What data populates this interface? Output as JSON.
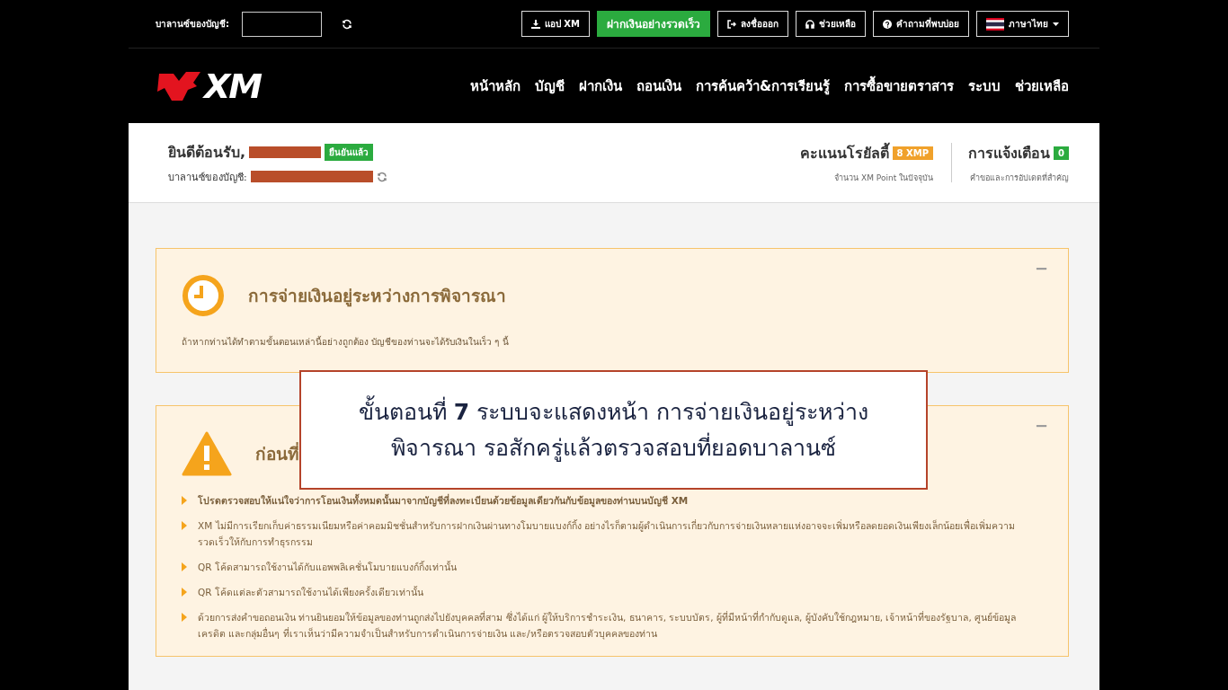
{
  "top_bar": {
    "balance_label": "บาลานซ์ของบัญชี:",
    "buttons": [
      {
        "kind": "download",
        "label": "แอป XM"
      },
      {
        "kind": "primary",
        "label": "ฝากเงินอย่างรวดเร็ว"
      },
      {
        "kind": "logout",
        "label": "ลงชื่อออก"
      },
      {
        "kind": "support",
        "label": "ช่วยเหลือ"
      },
      {
        "kind": "faq",
        "label": "คำถามที่พบบ่อย"
      },
      {
        "kind": "language",
        "label": "ภาษาไทย"
      }
    ]
  },
  "logo": "XM",
  "nav": [
    "หน้าหลัก",
    "บัญชี",
    "ฝากเงิน",
    "ถอนเงิน",
    "การค้นคว้า&การเรียนรู้",
    "การซื้อขายตราสาร",
    "ระบบ",
    "ช่วยเหลือ"
  ],
  "account_header": {
    "welcome": "ยินดีต้อนรับ,",
    "verified_badge": "ยืนยันแล้ว",
    "balance_label": "บาลานซ์ของบัญชี:",
    "loyalty": {
      "title": "คะแนนโรยัลตี้",
      "badge": "8 XMP",
      "subtitle": "จำนวน XM Point ในปัจจุบัน"
    },
    "notifications": {
      "title": "การแจ้งเตือน",
      "badge": "0",
      "subtitle": "คำขอและการอัปเดตที่สำคัญ"
    }
  },
  "panels": [
    {
      "kind": "clock",
      "title": "การจ่ายเงินอยู่ระหว่างการพิจารณา",
      "collapse": "−",
      "text": "ถ้าหากท่านได้ทำตามขั้นตอนเหล่านี้อย่างถูกต้อง บัญชีของท่านจะได้รับเงินในเร็ว ๆ นี้"
    },
    {
      "kind": "warning",
      "title": "ก่อนที่",
      "collapse": "−",
      "bullets": [
        "โปรดตรวจสอบให้แน่ใจว่าการโอนเงินทั้งหมดนั้นมาจากบัญชีที่ลงทะเบียนด้วยข้อมูลเดียวกันกับข้อมูลของท่านบนบัญชี XM",
        "XM ไม่มีการเรียกเก็บค่าธรรมเนียมหรือค่าคอมมิชชั่นสำหรับการฝากเงินผ่านทางโมบายแบงก์กิ้ง อย่างไรก็ตามผู้ดำเนินการเกี่ยวกับการจ่ายเงินหลายแห่งอาจจะเพิ่มหรือลดยอดเงินเพียงเล็กน้อยเพื่อเพิ่มความรวดเร็วให้กับการทำธุรกรรม",
        "QR โค้ดสามารถใช้งานได้กับแอพพลิเคชั่นโมบายแบงก์กิ้งเท่านั้น",
        "QR โค้ดแต่ละตัวสามารถใช้งานได้เพียงครั้งเดียวเท่านั้น",
        "ด้วยการส่งคำขอถอนเงิน ท่านยินยอมให้ข้อมูลของท่านถูกส่งไปยังบุคคลที่สาม ซึ่งได้แก่ ผู้ให้บริการชำระเงิน, ธนาคาร, ระบบบัตร, ผู้ที่มีหน้าที่กำกับดูแล, ผู้บังคับใช้กฎหมาย, เจ้าหน้าที่ของรัฐบาล, ศูนย์ข้อมูลเครดิต และกลุ่มอื่นๆ ที่เราเห็นว่ามีความจำเป็นสำหรับการดำเนินการจ่ายเงิน และ/หรือตรวจสอบตัวบุคคลของท่าน"
      ]
    }
  ],
  "caption": "ขั้นตอนที่ **7** ระบบจะแสดงหน้า การจ่ายเงินอยู่ระหว่างพิจารณา รอสักครู่แล้วตรวจสอบที่ยอดบาลานซ์"
}
